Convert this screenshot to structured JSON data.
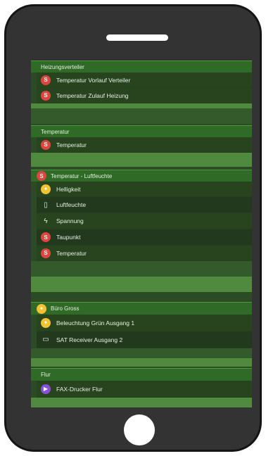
{
  "sections": [
    {
      "title": "Heizungsverteiler",
      "icon": "",
      "items": [
        {
          "label": "Temperatur Vorlauf Verteiler",
          "icon": "thermometer-icon"
        },
        {
          "label": "Temperatur Zulauf Heizung",
          "icon": "thermometer-icon"
        }
      ]
    },
    {
      "title": "Temperatur",
      "icon": "",
      "items": [
        {
          "label": "Temperatur",
          "icon": "thermometer-icon"
        }
      ]
    },
    {
      "title": "Temperatur - Luftfeuchte",
      "icon": "thermometer-icon",
      "items": [
        {
          "label": "Helligkeit",
          "icon": "sun-icon"
        },
        {
          "label": "Luftfeuchte",
          "icon": "humidity-icon"
        },
        {
          "label": "Spannung",
          "icon": "lightning-icon"
        },
        {
          "label": "Taupunkt",
          "icon": "thermometer-icon"
        },
        {
          "label": "Temperatur",
          "icon": "thermometer-icon"
        }
      ]
    },
    {
      "title": "Büro Gross",
      "icon": "sun-icon",
      "items": [
        {
          "label": "Beleuchtung Grün Ausgang 1",
          "icon": "sun-icon"
        },
        {
          "label": "SAT Receiver Ausgang 2",
          "icon": "monitor-icon"
        }
      ]
    },
    {
      "title": "Flur",
      "icon": "",
      "items": [
        {
          "label": "FAX-Drucker Flur",
          "icon": "play-icon"
        }
      ]
    }
  ],
  "colors": {
    "header": "#2f6a27",
    "row": "#27441f",
    "accent_red": "#e0453d",
    "accent_yellow": "#f2c230",
    "accent_purple": "#8a4fd3"
  }
}
